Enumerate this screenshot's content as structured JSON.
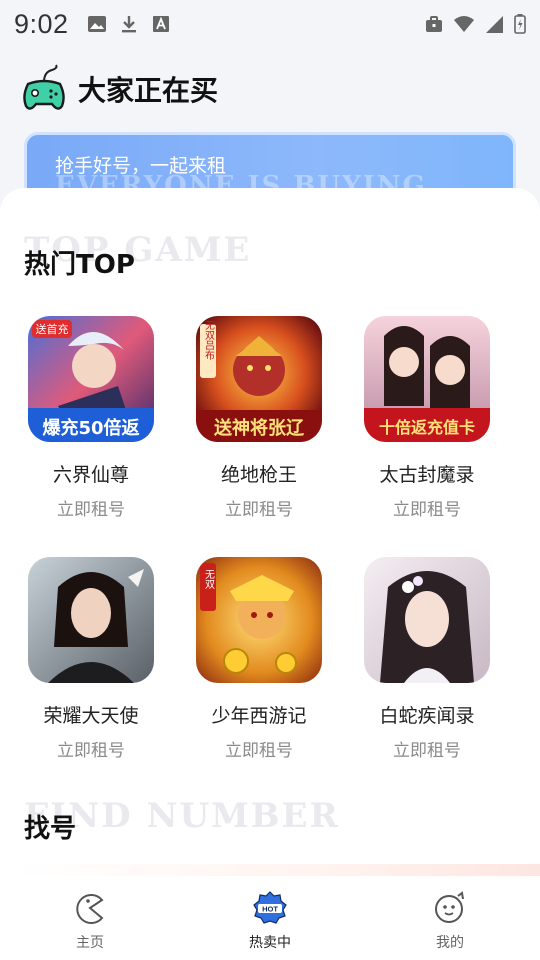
{
  "status_bar": {
    "time": "9:02",
    "left_icons": [
      "image-icon",
      "download-icon",
      "font-icon"
    ],
    "right_icons": [
      "briefcase-icon",
      "wifi-icon",
      "signal-icon",
      "battery-icon"
    ]
  },
  "header": {
    "title": "大家正在买",
    "logo_icon": "gamepad-icon"
  },
  "search": {
    "placeholder": "抢手好号，一起来租",
    "watermark": "EVERYONE IS BUYING"
  },
  "hot_section": {
    "title": "热门TOP",
    "watermark": "TOP GAME",
    "games": [
      {
        "name": "六界仙尊",
        "action": "立即租号",
        "icon_text": "爆充50倍返",
        "badge": "送首充"
      },
      {
        "name": "绝地枪王",
        "action": "立即租号",
        "icon_text": "送神将张辽",
        "badge": "无双吕布"
      },
      {
        "name": "太古封魔录",
        "action": "立即租号",
        "icon_text": "十倍返充值卡",
        "badge": ""
      },
      {
        "name": "荣耀大天使",
        "action": "立即租号",
        "icon_text": "",
        "badge": ""
      },
      {
        "name": "少年西游记",
        "action": "立即租号",
        "icon_text": "",
        "badge": "无双"
      },
      {
        "name": "白蛇疾闻录",
        "action": "立即租号",
        "icon_text": "",
        "badge": ""
      }
    ]
  },
  "find_section": {
    "title": "找号",
    "watermark": "FIND NUMBER"
  },
  "bottom_nav": {
    "items": [
      {
        "label": "主页",
        "icon": "home-pacman-icon",
        "active": false
      },
      {
        "label": "热卖中",
        "icon": "hot-badge-icon",
        "active": true
      },
      {
        "label": "我的",
        "icon": "profile-face-icon",
        "active": false
      }
    ]
  },
  "colors": {
    "banner_blue": "#79a9f7",
    "hot_icon_blue": "#2f6fe0",
    "logo_green": "#3fd0a8"
  }
}
